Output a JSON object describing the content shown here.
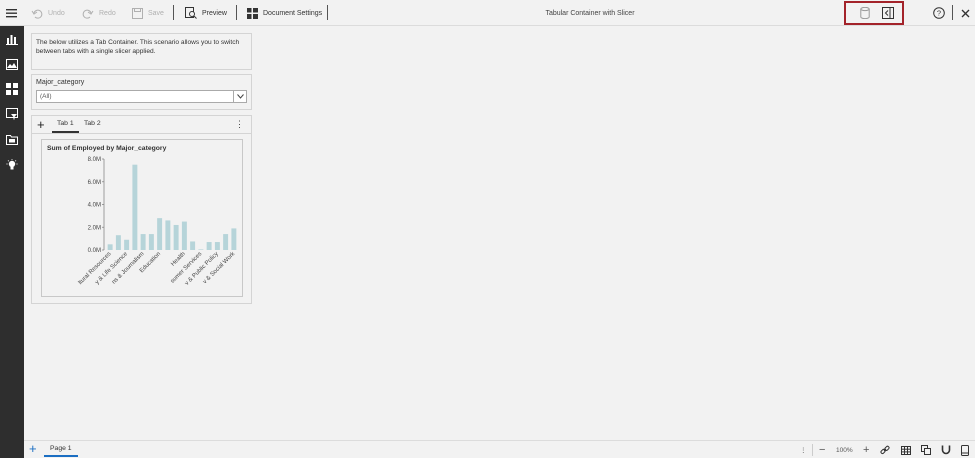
{
  "toolbar": {
    "undo_label": "Undo",
    "redo_label": "Redo",
    "save_label": "Save",
    "preview_label": "Preview",
    "document_settings_label": "Document Settings",
    "title": "Tabular Container with Slicer"
  },
  "description": "The below utilizes a Tab Container. This scenario allows you to switch between tabs with a single slicer applied.",
  "slicer": {
    "label": "Major_category",
    "selected": "(All)"
  },
  "tabs": [
    {
      "label": "Tab 1",
      "active": true
    },
    {
      "label": "Tab 2",
      "active": false
    }
  ],
  "chart_data": {
    "type": "bar",
    "title": "Sum of Employed by Major_category",
    "xlabel": "",
    "ylabel": "",
    "ylim": [
      0,
      8000000
    ],
    "yticks": [
      "0.0M",
      "2.0M",
      "4.0M",
      "6.0M",
      "8.0M"
    ],
    "ytick_values": [
      0,
      2000000,
      4000000,
      6000000,
      8000000
    ],
    "color": "#b6d4d9",
    "visible_xticks": [
      {
        "label": "Agriculture & Natural Resources",
        "display": "ltural Resources",
        "index": 0
      },
      {
        "label": "Biology & Life Science",
        "display": "y & Life Science",
        "index": 2
      },
      {
        "label": "Communications & Journalism",
        "display": "ns & Journalism",
        "index": 4
      },
      {
        "label": "Education",
        "display": "Education",
        "index": 6
      },
      {
        "label": "Health",
        "display": "Health",
        "index": 9
      },
      {
        "label": "Industrial Arts & Consumer Services",
        "display": "sumer Services",
        "index": 11
      },
      {
        "label": "Law & Public Policy",
        "display": "v & Public Policy",
        "index": 13
      },
      {
        "label": "Psychology & Social Work",
        "display": "v & Social Work",
        "index": 15
      }
    ],
    "values": [
      500000,
      1300000,
      900000,
      7500000,
      1400000,
      1400000,
      2800000,
      2600000,
      2200000,
      2500000,
      750000,
      50000,
      700000,
      700000,
      1400000,
      1900000
    ]
  },
  "bottombar": {
    "page_label": "Page 1",
    "zoom": "100%"
  },
  "colors": {
    "rail_bg": "#2e2e2e",
    "highlight_border": "#a3232a",
    "accent": "#1b6ec2"
  }
}
